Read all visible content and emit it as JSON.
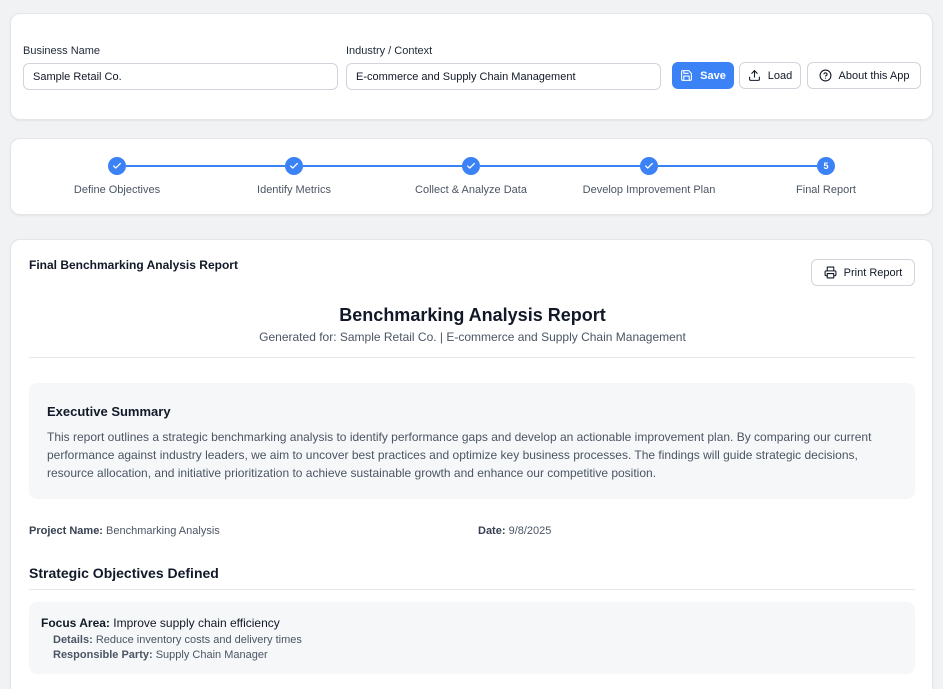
{
  "header": {
    "business_name_label": "Business Name",
    "business_name_value": "Sample Retail Co.",
    "industry_label": "Industry / Context",
    "industry_value": "E-commerce and Supply Chain Management",
    "save_label": "Save",
    "load_label": "Load",
    "about_label": "About this App"
  },
  "stepper": {
    "steps": [
      {
        "label": "Define Objectives",
        "state": "complete"
      },
      {
        "label": "Identify Metrics",
        "state": "complete"
      },
      {
        "label": "Collect & Analyze Data",
        "state": "complete"
      },
      {
        "label": "Develop Improvement Plan",
        "state": "complete"
      },
      {
        "label": "Final Report",
        "state": "current",
        "number": "5"
      }
    ]
  },
  "report": {
    "heading": "Final Benchmarking Analysis Report",
    "print_label": "Print Report",
    "title": "Benchmarking Analysis Report",
    "subtitle": "Generated for: Sample Retail Co. | E-commerce and Supply Chain Management",
    "summary_title": "Executive Summary",
    "summary_text": "This report outlines a strategic benchmarking analysis to identify performance gaps and develop an actionable improvement plan. By comparing our current performance against industry leaders, we aim to uncover best practices and optimize key business processes. The findings will guide strategic decisions, resource allocation, and initiative prioritization to achieve sustainable growth and enhance our competitive position.",
    "project_name_label": "Project Name:",
    "project_name_value": "Benchmarking Analysis",
    "date_label": "Date:",
    "date_value": "9/8/2025",
    "objectives_title": "Strategic Objectives Defined",
    "objective": {
      "focus_label": "Focus Area:",
      "focus_value": "Improve supply chain efficiency",
      "details_label": "Details:",
      "details_value": "Reduce inventory costs and delivery times",
      "party_label": "Responsible Party:",
      "party_value": "Supply Chain Manager"
    }
  },
  "colors": {
    "accent": "#3b82f6",
    "background": "#f1f2f4",
    "panel": "#f6f7f9"
  },
  "icons": [
    "save-icon",
    "upload-icon",
    "help-circle-icon",
    "check-icon",
    "printer-icon"
  ]
}
